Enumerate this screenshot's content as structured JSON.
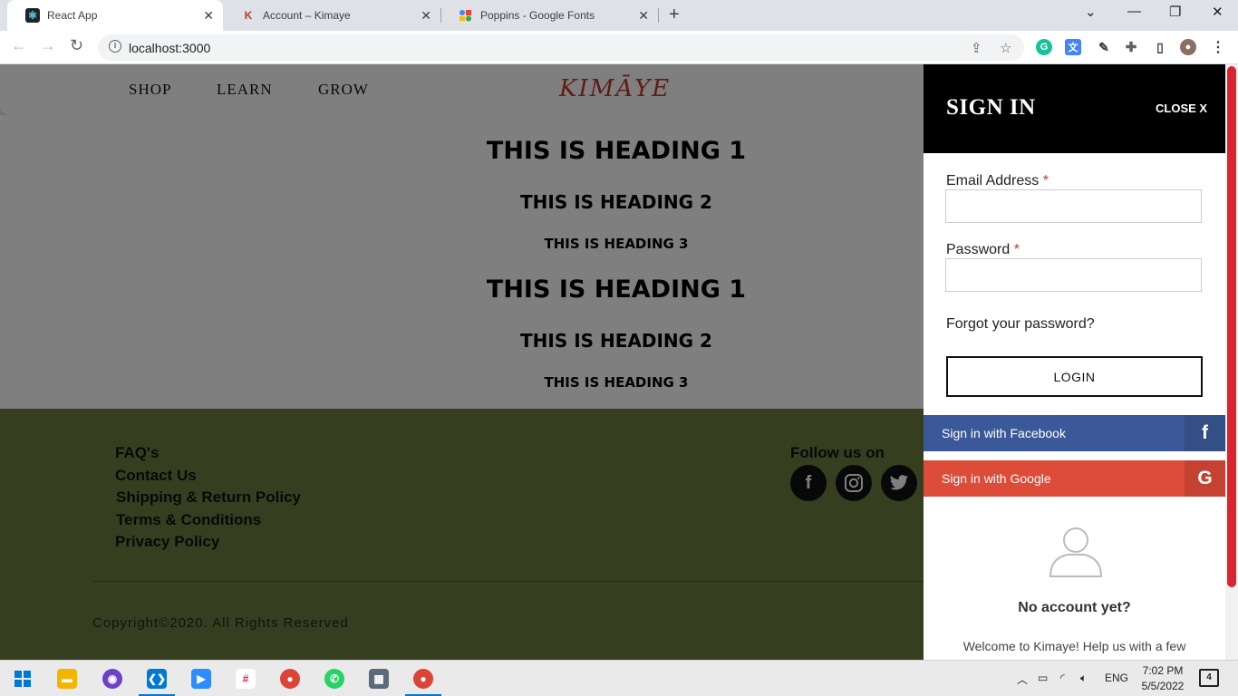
{
  "browser": {
    "tabs": [
      {
        "title": "React App",
        "favicon": "react-icon"
      },
      {
        "title": "Account – Kimaye",
        "favicon": "kimaye-icon"
      },
      {
        "title": "Poppins - Google Fonts",
        "favicon": "google-fonts-icon"
      }
    ],
    "new_tab_glyph": "+",
    "url": "localhost:3000"
  },
  "site": {
    "nav": [
      "SHOP",
      "LEARN",
      "GROW"
    ],
    "logo": "KIMĀYE",
    "headings": [
      {
        "text": "THIS IS HEADING 1",
        "level": 1
      },
      {
        "text": "THIS IS HEADING 2",
        "level": 2
      },
      {
        "text": "THIS IS HEADING 3",
        "level": 3
      },
      {
        "text": "THIS IS HEADING 1",
        "level": 1
      },
      {
        "text": "THIS IS HEADING 2",
        "level": 2
      },
      {
        "text": "THIS IS HEADING 3",
        "level": 3
      }
    ],
    "footer": {
      "links": [
        "FAQ's",
        "Contact Us",
        "Shipping & Return Policy",
        "Terms & Conditions",
        "Privacy Policy"
      ],
      "follow_label": "Follow us on",
      "socials": [
        "facebook-icon",
        "instagram-icon",
        "twitter-icon"
      ],
      "copyright": "Copyright©2020. All Rights Reserved"
    }
  },
  "signin": {
    "title": "SIGN IN",
    "close_label": "CLOSE X",
    "email_label": "Email Address",
    "password_label": "Password",
    "required_mark": "*",
    "email_value": "",
    "password_value": "",
    "forgot_label": "Forgot your password?",
    "login_label": "LOGIN",
    "facebook_label": "Sign in with Facebook",
    "facebook_glyph": "f",
    "google_label": "Sign in with Google",
    "google_glyph": "G",
    "no_account": "No account yet?",
    "welcome": "Welcome to Kimaye! Help us with a few"
  },
  "taskbar": {
    "apps": [
      "start-icon",
      "file-explorer-icon",
      "github-desktop-icon",
      "vscode-icon",
      "zoom-icon",
      "slack-icon",
      "chrome-icon",
      "whatsapp-icon",
      "calculator-icon",
      "chrome-profile-icon"
    ],
    "language": "ENG",
    "time": "7:02 PM",
    "date": "5/5/2022",
    "notification_count": "4"
  },
  "colors": {
    "footer_bg": "#6b7f3e",
    "facebook": "#3b5998",
    "google": "#dd4b39",
    "accent_red": "#d9252f"
  }
}
